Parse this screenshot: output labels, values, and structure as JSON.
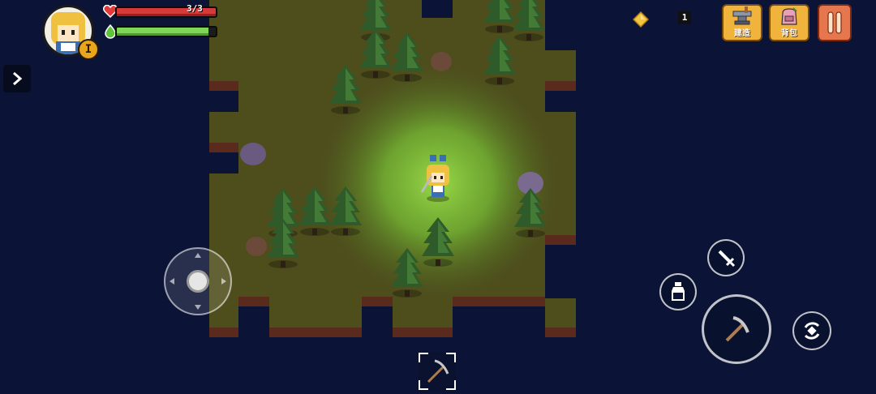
{
  "hud": {
    "hp_text": "3/3",
    "hp_fraction": 1.0,
    "energy_fraction": 0.93,
    "level_badge": "I",
    "gem_count": "1",
    "build_label": "建造",
    "bag_label": "背包"
  },
  "icons": {
    "heart": "heart-icon",
    "energy": "energy-drop-icon",
    "gem": "gem-icon",
    "expand": "chevron-right-icon",
    "build": "anvil-icon",
    "bag": "backpack-icon",
    "menu": "scroll-icon",
    "attack": "sword-icon",
    "potion": "potion-icon",
    "tool": "pickaxe-icon",
    "dodge": "dodge-roll-icon"
  },
  "colors": {
    "sea": "#0b1436",
    "grass": "#5a5a22",
    "hp": "#d63a3a",
    "energy": "#7fd45a",
    "gold": "#f0b33b",
    "light": "#7ec83a"
  }
}
